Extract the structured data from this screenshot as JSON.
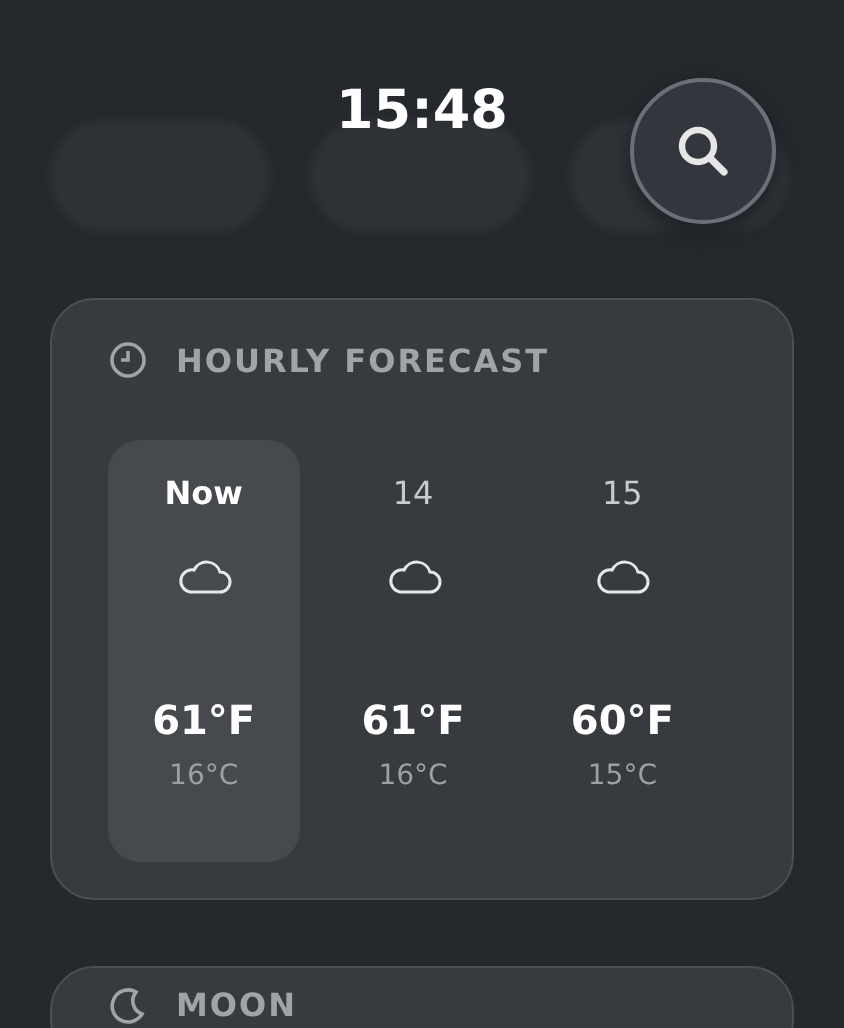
{
  "clock": "15:48",
  "hourly_forecast": {
    "title": "HOURLY FORECAST",
    "hours": [
      {
        "label": "Now",
        "selected": true,
        "temp_f": "61°F",
        "temp_c": "16°C"
      },
      {
        "label": "14",
        "selected": false,
        "temp_f": "61°F",
        "temp_c": "16°C"
      },
      {
        "label": "15",
        "selected": false,
        "temp_f": "60°F",
        "temp_c": "15°C"
      }
    ]
  },
  "moon": {
    "title": "MOON"
  }
}
